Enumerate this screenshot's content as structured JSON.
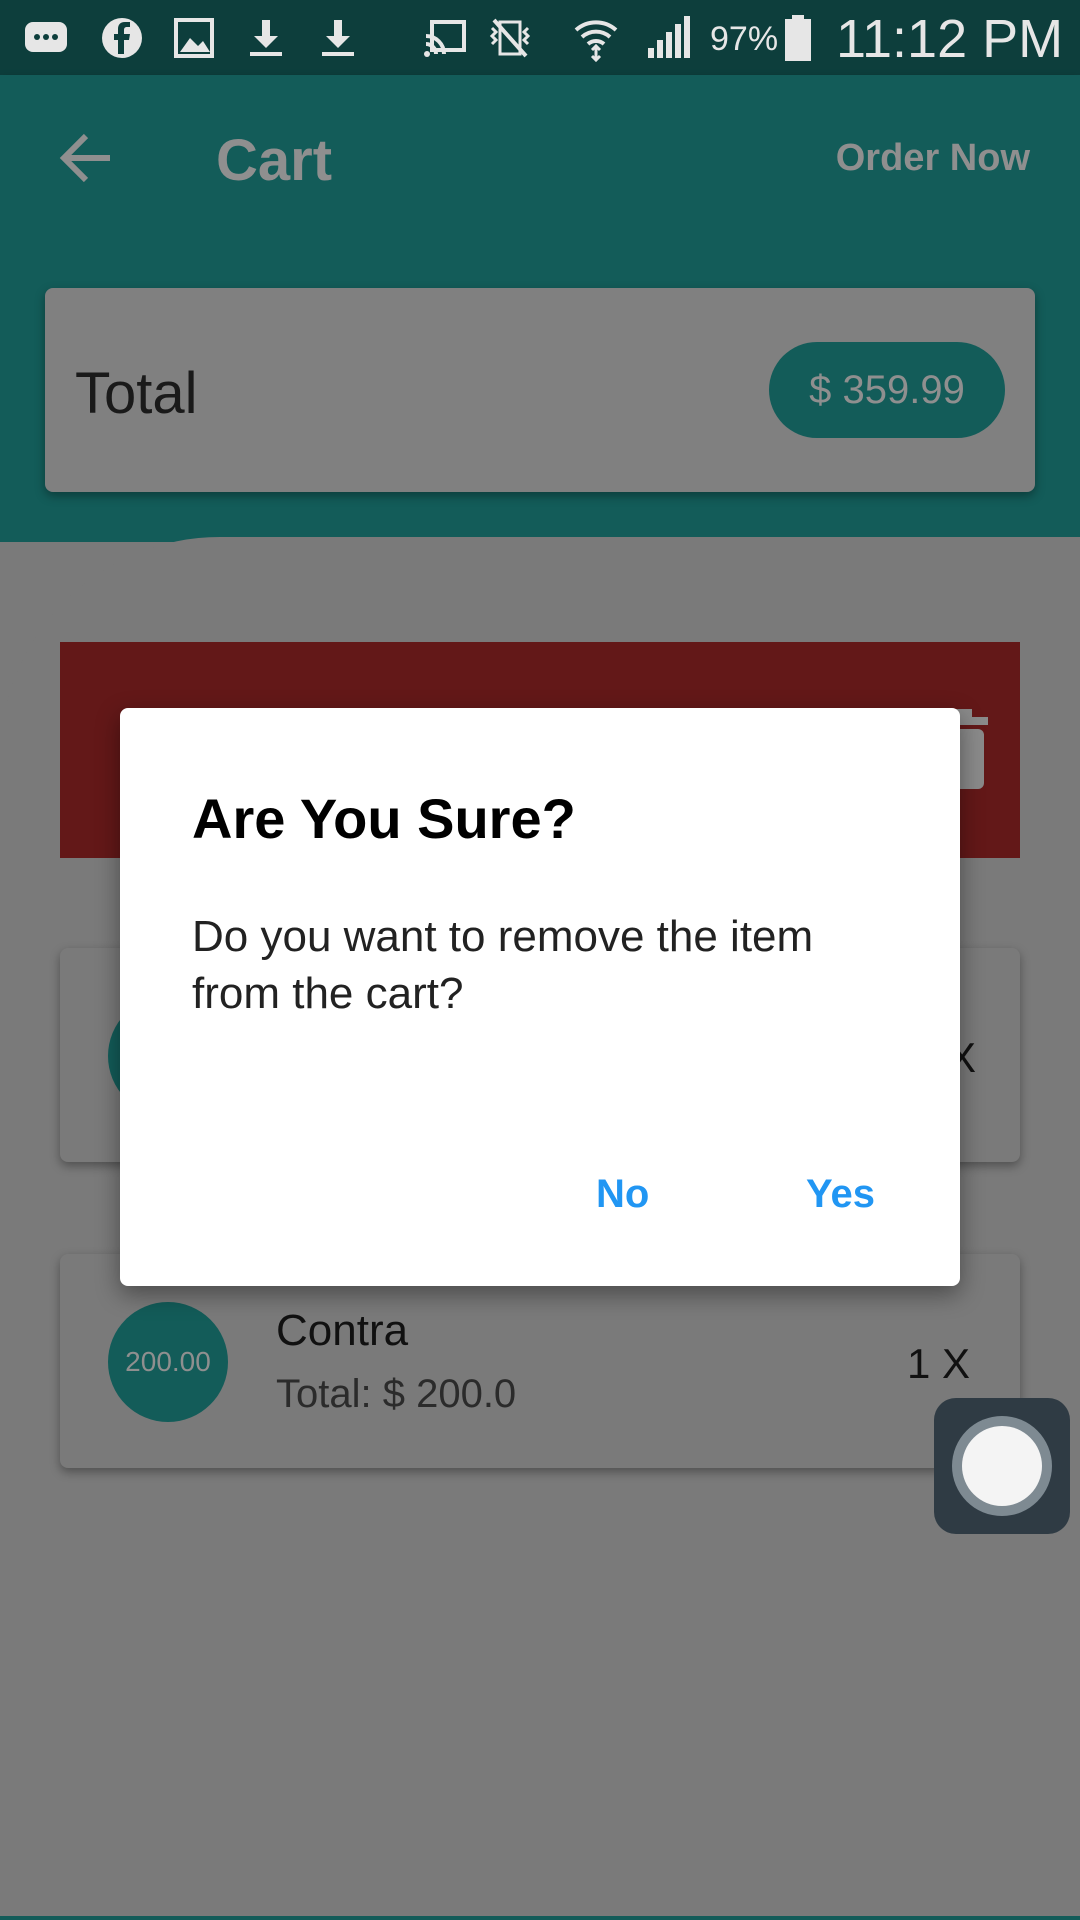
{
  "status_bar": {
    "battery": "97%",
    "time": "11:12 PM",
    "icons": [
      "message-icon",
      "facebook-icon",
      "image-icon",
      "download-icon",
      "download-icon",
      "cast-icon",
      "vibrate-icon",
      "wifi-icon",
      "signal-icon",
      "battery-icon"
    ]
  },
  "app_bar": {
    "title": "Cart",
    "action": "Order Now",
    "back_icon": "arrow-back-icon"
  },
  "summary": {
    "label": "Total",
    "amount": "$ 359.99"
  },
  "cart_items": [
    {
      "avatar": "200.00",
      "name": "Contra",
      "total": "Total: $ 200.0",
      "qty": "1 X"
    }
  ],
  "dialog": {
    "title": "Are You Sure?",
    "message": "Do you want to remove the item from the cart?",
    "no_label": "No",
    "yes_label": "Yes"
  },
  "colors": {
    "primary": "#135c59",
    "status_bar": "#0d3e3c",
    "delete": "#631818",
    "accent_button": "#2196f3"
  }
}
